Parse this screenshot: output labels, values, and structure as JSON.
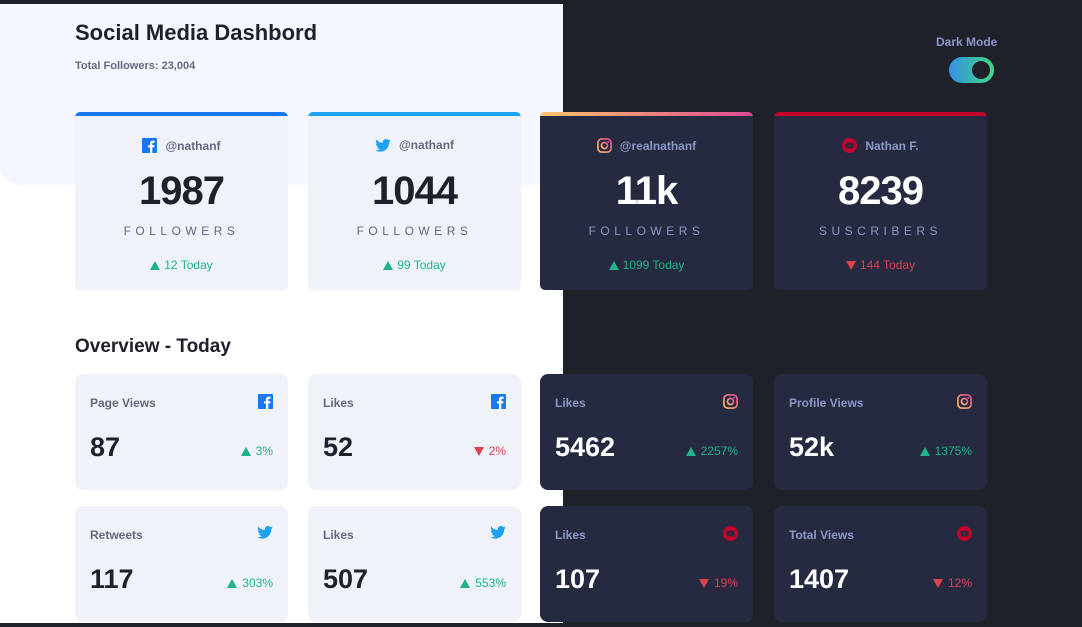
{
  "header": {
    "title": "Social Media Dashbord",
    "total_followers": "Total Followers: 23,004",
    "toggle_label": "Dark Mode"
  },
  "colors": {
    "facebook": "#1877f2",
    "twitter": "#1da1f2",
    "instagram_gradient": [
      "#fdc468",
      "#df4996"
    ],
    "youtube": "#c4032a",
    "up": "#1db489",
    "down": "#dc414c",
    "toggle_gradient": [
      "#378fe6",
      "#3eda82"
    ]
  },
  "cards": [
    {
      "network": "facebook",
      "icon": "facebook-icon",
      "handle": "@nathanf",
      "count": "1987",
      "unit": "FOLLOWERS",
      "change": "12 Today",
      "direction": "up"
    },
    {
      "network": "twitter",
      "icon": "twitter-icon",
      "handle": "@nathanf",
      "count": "1044",
      "unit": "FOLLOWERS",
      "change": "99 Today",
      "direction": "up"
    },
    {
      "network": "instagram",
      "icon": "instagram-icon",
      "handle": "@realnathanf",
      "count": "11k",
      "unit": "FOLLOWERS",
      "change": "1099 Today",
      "direction": "up"
    },
    {
      "network": "youtube",
      "icon": "youtube-icon",
      "handle": "Nathan F.",
      "count": "8239",
      "unit": "SUSCRIBERS",
      "change": "144 Today",
      "direction": "down"
    }
  ],
  "overview": {
    "title": "Overview - Today",
    "items": [
      {
        "label": "Page Views",
        "icon": "facebook-icon",
        "value": "87",
        "pct": "3%",
        "direction": "up"
      },
      {
        "label": "Likes",
        "icon": "facebook-icon",
        "value": "52",
        "pct": "2%",
        "direction": "down"
      },
      {
        "label": "Likes",
        "icon": "instagram-icon",
        "value": "5462",
        "pct": "2257%",
        "direction": "up"
      },
      {
        "label": "Profile Views",
        "icon": "instagram-icon",
        "value": "52k",
        "pct": "1375%",
        "direction": "up"
      },
      {
        "label": "Retweets",
        "icon": "twitter-icon",
        "value": "117",
        "pct": "303%",
        "direction": "up"
      },
      {
        "label": "Likes",
        "icon": "twitter-icon",
        "value": "507",
        "pct": "553%",
        "direction": "up"
      },
      {
        "label": "Likes",
        "icon": "youtube-icon",
        "value": "107",
        "pct": "19%",
        "direction": "down"
      },
      {
        "label": "Total Views",
        "icon": "youtube-icon",
        "value": "1407",
        "pct": "12%",
        "direction": "down"
      }
    ]
  }
}
